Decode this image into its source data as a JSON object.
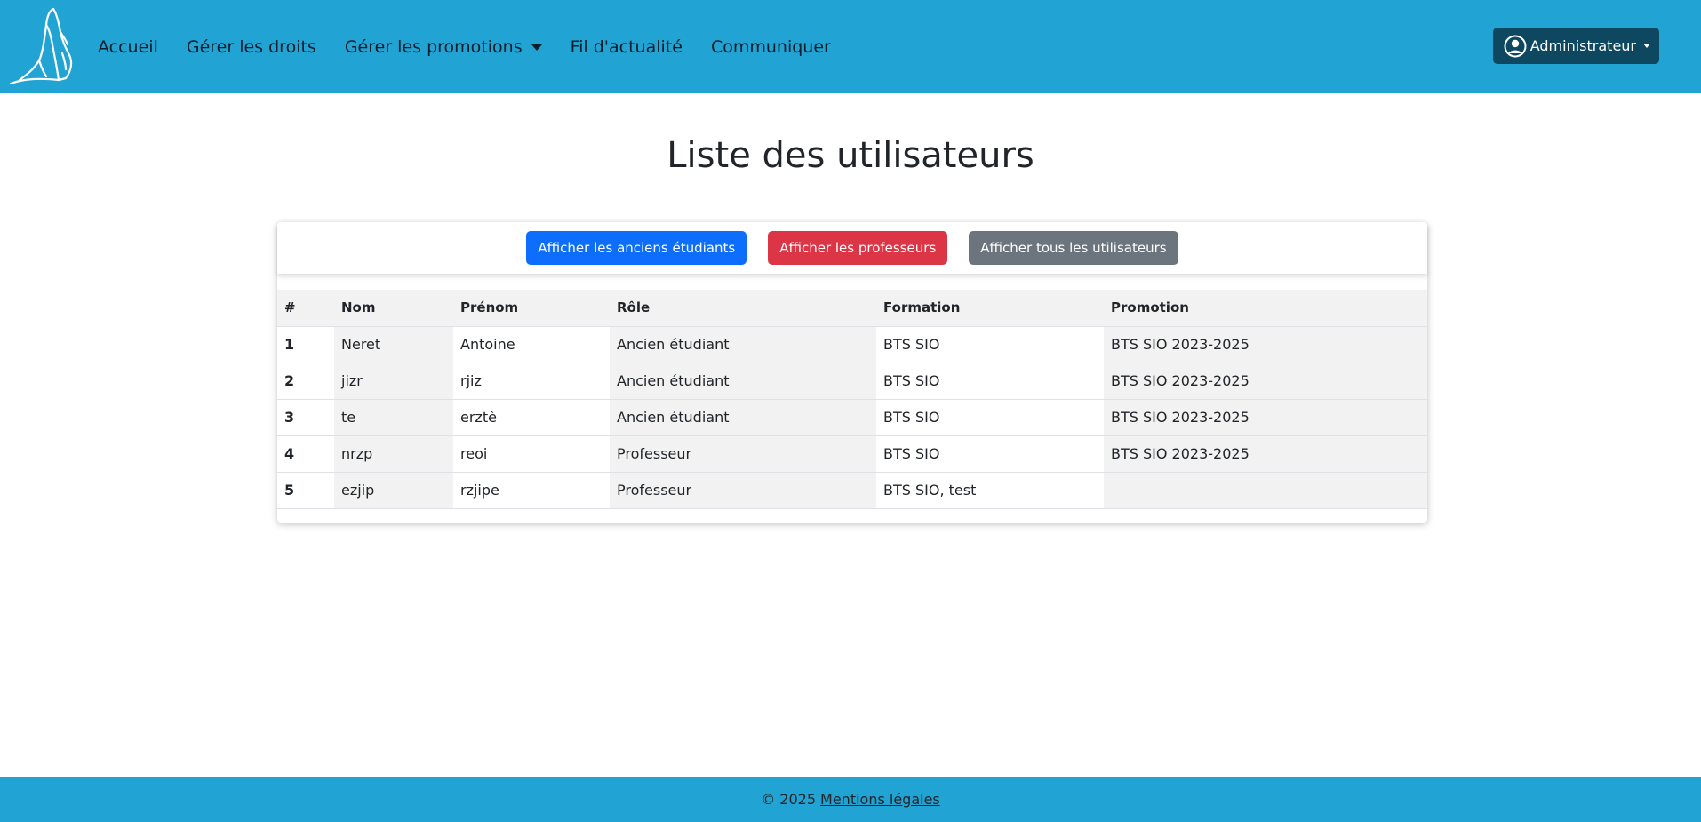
{
  "navbar": {
    "links": [
      {
        "label": "Accueil"
      },
      {
        "label": "Gérer les droits"
      },
      {
        "label": "Gérer les promotions"
      },
      {
        "label": "Fil d'actualité"
      },
      {
        "label": "Communiquer"
      }
    ],
    "user_menu": {
      "label": "Administrateur"
    },
    "color": "#21a3d3"
  },
  "main": {
    "title": "Liste des utilisateurs",
    "buttons": {
      "former_students": "Afficher les anciens étudiants",
      "professors": "Afficher les professeurs",
      "all_users": "Afficher tous les utilisateurs"
    },
    "table": {
      "headers": [
        "#",
        "Nom",
        "Prénom",
        "Rôle",
        "Formation",
        "Promotion"
      ],
      "rows": [
        [
          "1",
          "Neret",
          "Antoine",
          "Ancien étudiant",
          "BTS SIO",
          "BTS SIO 2023-2025"
        ],
        [
          "2",
          "jizr",
          "rjiz",
          "Ancien étudiant",
          "BTS SIO",
          "BTS SIO 2023-2025"
        ],
        [
          "3",
          "te",
          "erztè",
          "Ancien étudiant",
          "BTS SIO",
          "BTS SIO 2023-2025"
        ],
        [
          "4",
          "nrzp",
          "reoi",
          "Professeur",
          "BTS SIO",
          "BTS SIO 2023-2025"
        ],
        [
          "5",
          "ezjip",
          "rzjipe",
          "Professeur",
          "BTS SIO, test",
          ""
        ]
      ]
    }
  },
  "footer": {
    "copyright": "© 2025",
    "legal_link": "Mentions légales"
  },
  "colors": {
    "primary_button": "#0d6efd",
    "danger_button": "#dc3545",
    "secondary_button": "#6c757d",
    "admin_button": "#0d4760"
  }
}
